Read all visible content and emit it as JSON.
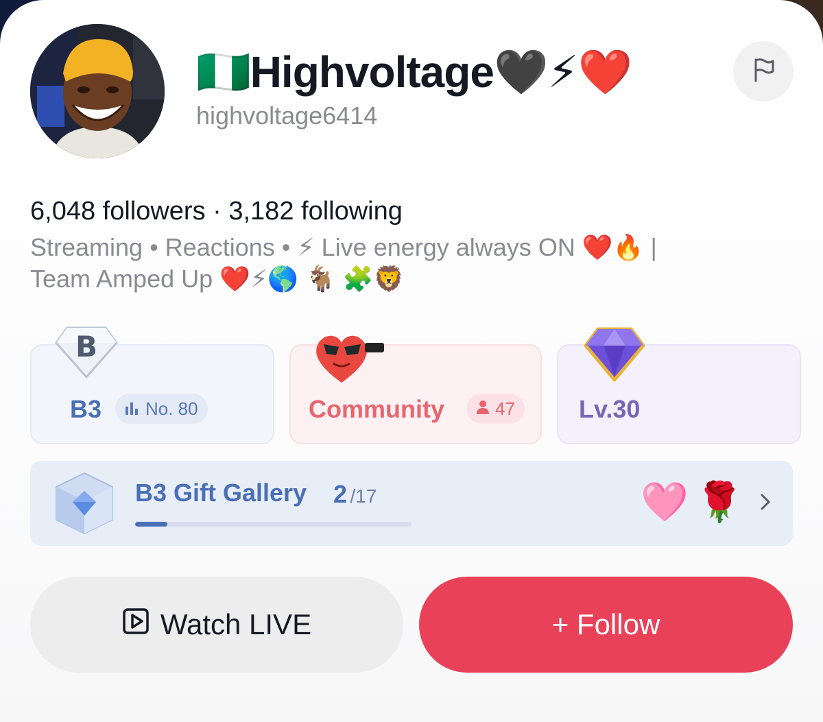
{
  "profile": {
    "display_name": "🇳🇬Highvoltage🖤⚡❤️",
    "username": "highvoltage6414",
    "counts_line": "6,048 followers · 3,182 following",
    "bio_line1": "Streaming • Reactions • ⚡ Live energy always ON ❤️🔥 |",
    "bio_line2": "Team Amped Up ❤️⚡🌎 🐐 🧩🦁"
  },
  "stats": {
    "b3": {
      "badge_letter": "B",
      "label": "B3",
      "rank_label": "No. 80"
    },
    "community": {
      "label": "Community",
      "member_count": "47"
    },
    "level": {
      "label": "Lv.30"
    }
  },
  "gallery": {
    "title": "B3 Gift Gallery",
    "count": "2",
    "total": "/17",
    "progress_fraction": 0.1176,
    "gifts": [
      "🩷",
      "🌹"
    ]
  },
  "actions": {
    "watch_label": "Watch LIVE",
    "follow_label": "+ Follow"
  },
  "colors": {
    "follow_button": "#e94158",
    "b3_accent": "#4a6fb5",
    "community_accent": "#e8656e",
    "level_accent": "#7467b8"
  }
}
